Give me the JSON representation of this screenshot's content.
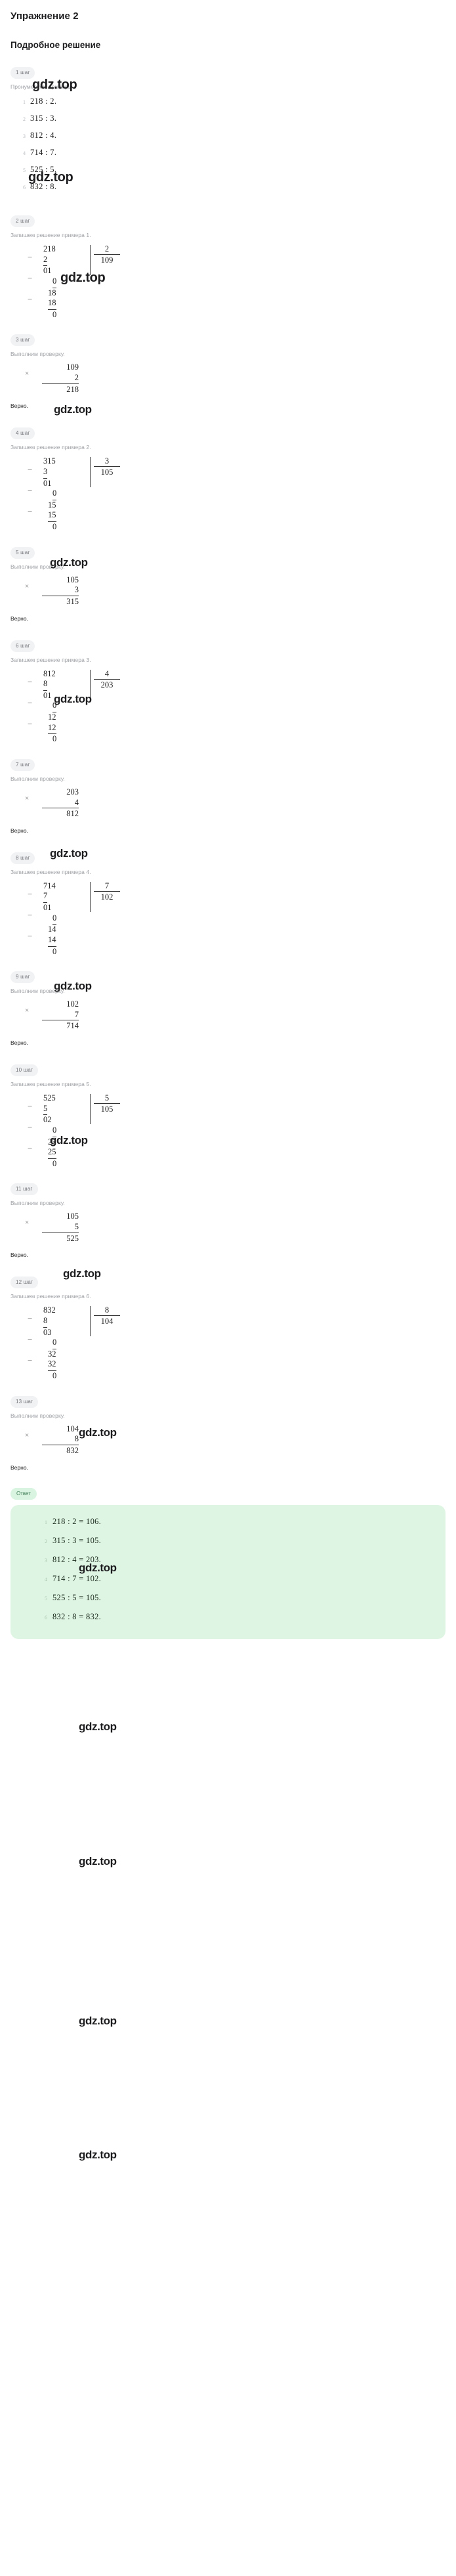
{
  "header": {
    "exercise_title": "Упражнение 2",
    "solution_title": "Подробное решение"
  },
  "watermark": {
    "text": "gdz.top"
  },
  "labels": {
    "step_1": "1 шаг",
    "step_2": "2 шаг",
    "step_3": "3 шаг",
    "step_4": "4 шаг",
    "step_5": "5 шаг",
    "step_6": "6 шаг",
    "step_7": "7 шаг",
    "step_8": "8 шаг",
    "step_9": "9 шаг",
    "step_10": "10 шаг",
    "step_11": "11 шаг",
    "step_12": "12 шаг",
    "step_13": "13 шаг",
    "answer_badge": "Ответ",
    "verdict": "Верно.",
    "text_number": "Пронумеруем примеры.",
    "text_write_1": "Запишем решение примера 1.",
    "text_write_2": "Запишем решение примера 2.",
    "text_write_3": "Запишем решение примера 3.",
    "text_write_4": "Запишем решение примера 4.",
    "text_write_5": "Запишем решение примера 5.",
    "text_write_6": "Запишем решение примера 6.",
    "text_check": "Выполним проверку."
  },
  "examples": [
    {
      "n": "1",
      "expr": "218 : 2."
    },
    {
      "n": "2",
      "expr": "315 : 3."
    },
    {
      "n": "3",
      "expr": "812 : 4."
    },
    {
      "n": "4",
      "expr": "714 : 7."
    },
    {
      "n": "5",
      "expr": "525 : 5."
    },
    {
      "n": "6",
      "expr": "832 : 8."
    }
  ],
  "divisions": [
    {
      "id": "div-218-2",
      "dividend": "218",
      "divisor": "2",
      "quotient": "109",
      "sub1": "2",
      "rem1": "01",
      "sub2": "0",
      "rem2": "18",
      "sub3": "18",
      "rem3": "0"
    },
    {
      "id": "div-315-3",
      "dividend": "315",
      "divisor": "3",
      "quotient": "105",
      "sub1": "3",
      "rem1": "01",
      "sub2": "0",
      "rem2": "15",
      "sub3": "15",
      "rem3": "0"
    },
    {
      "id": "div-812-4",
      "dividend": "812",
      "divisor": "4",
      "quotient": "203",
      "sub1": "8",
      "rem1": "01",
      "sub2": "0",
      "rem2": "12",
      "sub3": "12",
      "rem3": "0"
    },
    {
      "id": "div-714-7",
      "dividend": "714",
      "divisor": "7",
      "quotient": "102",
      "sub1": "7",
      "rem1": "01",
      "sub2": "0",
      "rem2": "14",
      "sub3": "14",
      "rem3": "0"
    },
    {
      "id": "div-525-5",
      "dividend": "525",
      "divisor": "5",
      "quotient": "105",
      "sub1": "5",
      "rem1": "02",
      "sub2": "0",
      "rem2": "25",
      "sub3": "25",
      "rem3": "0"
    },
    {
      "id": "div-832-8",
      "dividend": "832",
      "divisor": "8",
      "quotient": "104",
      "sub1": "8",
      "rem1": "03",
      "sub2": "0",
      "rem2": "32",
      "sub3": "32",
      "rem3": "0"
    }
  ],
  "checks": [
    {
      "id": "chk-109x2",
      "top": "109",
      "mid": "2",
      "result": "218"
    },
    {
      "id": "chk-105x3",
      "top": "105",
      "mid": "3",
      "result": "315"
    },
    {
      "id": "chk-203x4",
      "top": "203",
      "mid": "4",
      "result": "812"
    },
    {
      "id": "chk-102x7",
      "top": "102",
      "mid": "7",
      "result": "714"
    },
    {
      "id": "chk-105x5",
      "top": "105",
      "mid": "5",
      "result": "525"
    },
    {
      "id": "chk-104x8",
      "top": "104",
      "mid": "8",
      "result": "832"
    }
  ],
  "answers": [
    {
      "n": "1",
      "expr": "218 : 2 = 106."
    },
    {
      "n": "2",
      "expr": "315 : 3 = 105."
    },
    {
      "n": "3",
      "expr": "812 : 4 = 203."
    },
    {
      "n": "4",
      "expr": "714 : 7 = 102."
    },
    {
      "n": "5",
      "expr": "525 : 5 = 105."
    },
    {
      "n": "6",
      "expr": "832 : 8 = 832."
    }
  ],
  "colors": {
    "step_badge_bg": "#f1f2f4",
    "step_badge_fg": "#6f7276",
    "answer_bg": "#dff5e4",
    "answer_badge_bg": "#d9f5e1",
    "text_muted": "#9b9ea3"
  }
}
